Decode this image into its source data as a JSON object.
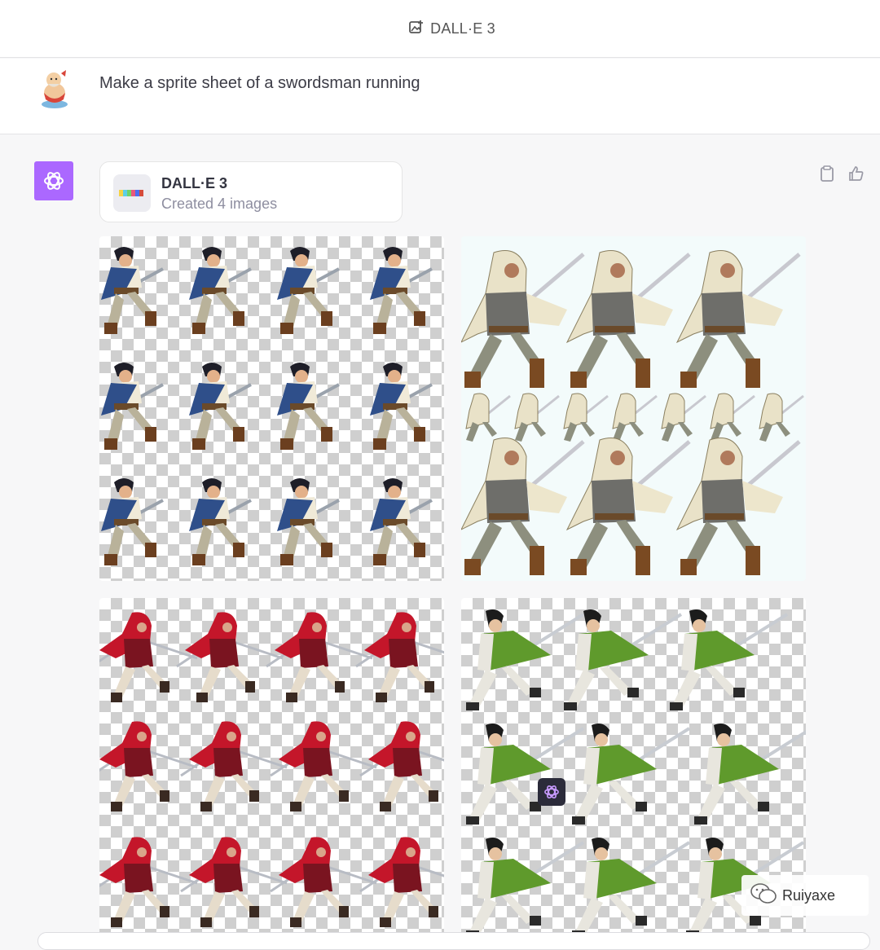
{
  "header": {
    "title": "DALL·E 3",
    "icon": "image-plus-icon"
  },
  "user_message": {
    "avatar": "user-figurine-avatar",
    "text": "Make a sprite sheet of a swordsman running"
  },
  "assistant": {
    "avatar": "openai-logo-icon",
    "avatar_color": "#ab68ff",
    "tool_card": {
      "name": "DALL·E 3",
      "status": "Created 4 images"
    },
    "actions": [
      "clipboard-icon",
      "thumbs-up-icon"
    ],
    "images": [
      {
        "subject": "blue-tunic-swordsman-sprite-sheet",
        "accent": "#2f4f8a"
      },
      {
        "subject": "hooded-assassin-sprite-sheet",
        "accent": "#e9e2c8"
      },
      {
        "subject": "red-hooded-swordsman-sprite-sheet",
        "accent": "#c4162a"
      },
      {
        "subject": "green-robed-samurai-sprite-sheet",
        "accent": "#5f9a2c"
      }
    ]
  },
  "watermark": {
    "text": "Ruiyaxe"
  }
}
